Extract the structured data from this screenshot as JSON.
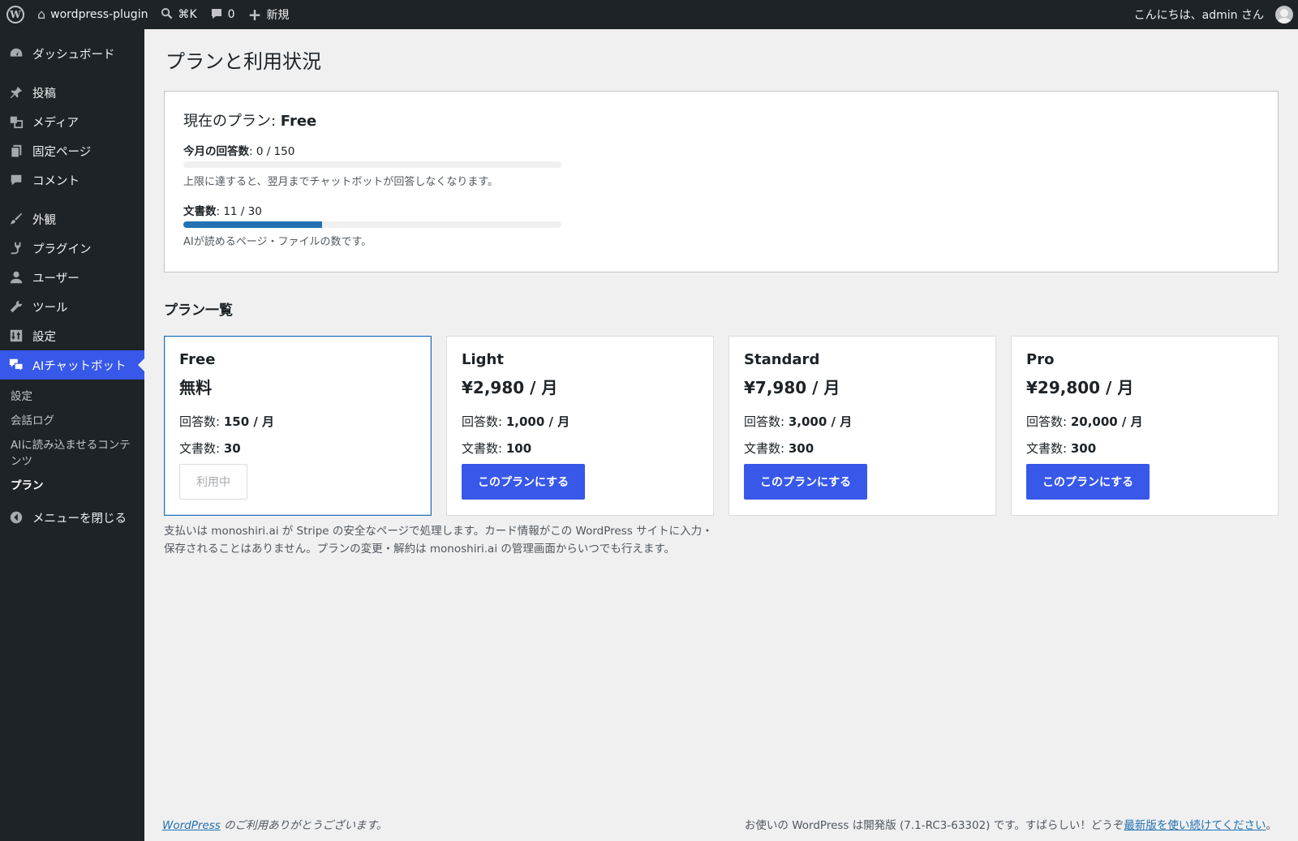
{
  "adminbar": {
    "site_name": "wordpress-plugin",
    "search_shortcut": "⌘K",
    "comments_count": "0",
    "new_label": "新規",
    "greeting": "こんにちは、admin さん"
  },
  "sidebar": {
    "items": [
      {
        "label": "ダッシュボード",
        "icon": "dashboard-icon"
      },
      {
        "label": "投稿",
        "icon": "pin-icon"
      },
      {
        "label": "メディア",
        "icon": "media-icon"
      },
      {
        "label": "固定ページ",
        "icon": "page-icon"
      },
      {
        "label": "コメント",
        "icon": "comment-icon"
      },
      {
        "label": "外観",
        "icon": "brush-icon"
      },
      {
        "label": "プラグイン",
        "icon": "plugin-icon"
      },
      {
        "label": "ユーザー",
        "icon": "user-icon"
      },
      {
        "label": "ツール",
        "icon": "wrench-icon"
      },
      {
        "label": "設定",
        "icon": "settings-icon"
      },
      {
        "label": "AIチャットボット",
        "icon": "chat-icon"
      }
    ],
    "submenu": [
      "設定",
      "会話ログ",
      "AIに読み込ませるコンテンツ",
      "プラン"
    ],
    "collapse_label": "メニューを閉じる"
  },
  "main": {
    "title": "プランと利用状況",
    "status": {
      "plan_prefix": "現在のプラン: ",
      "plan_name": "Free",
      "answers_label": "今月の回答数",
      "answers_value": ": 0 / 150",
      "answers_progress": 0,
      "answers_note": "上限に達すると、翌月までチャットボットが回答しなくなります。",
      "docs_label": "文書数",
      "docs_value": ": 11 / 30",
      "docs_progress": 0.367,
      "docs_note": "AIが読めるページ・ファイルの数です。"
    },
    "plans_title": "プラン一覧",
    "plans": [
      {
        "name": "Free",
        "price": "無料",
        "answers_label": "回答数: ",
        "answers": "150 / 月",
        "docs_label": "文書数: ",
        "docs": "30",
        "button": "利用中",
        "active": true
      },
      {
        "name": "Light",
        "price": "¥2,980 / 月",
        "answers_label": "回答数: ",
        "answers": "1,000 / 月",
        "docs_label": "文書数: ",
        "docs": "100",
        "button": "このプランにする",
        "active": false
      },
      {
        "name": "Standard",
        "price": "¥7,980 / 月",
        "answers_label": "回答数: ",
        "answers": "3,000 / 月",
        "docs_label": "文書数: ",
        "docs": "300",
        "button": "このプランにする",
        "active": false
      },
      {
        "name": "Pro",
        "price": "¥29,800 / 月",
        "answers_label": "回答数: ",
        "answers": "20,000 / 月",
        "docs_label": "文書数: ",
        "docs": "300",
        "button": "このプランにする",
        "active": false
      }
    ],
    "disclaimer_line1": "支払いは monoshiri.ai が Stripe の安全なページで処理します。カード情報がこの WordPress サイトに入力・",
    "disclaimer_line2": "保存されることはありません。プランの変更・解約は monoshiri.ai の管理画面からいつでも行えます。"
  },
  "footer": {
    "left_link": "WordPress",
    "left_text": " のご利用ありがとうございます。",
    "right_text": "お使いの WordPress は開発版 (7.1-RC3-63302) です。すばらしい！どうぞ",
    "right_link": "最新版を使い続けてください",
    "right_end": "。"
  },
  "colors": {
    "accent": "#3858e9",
    "sidebar_bg": "#1d2327",
    "progress": "#2271b1"
  }
}
